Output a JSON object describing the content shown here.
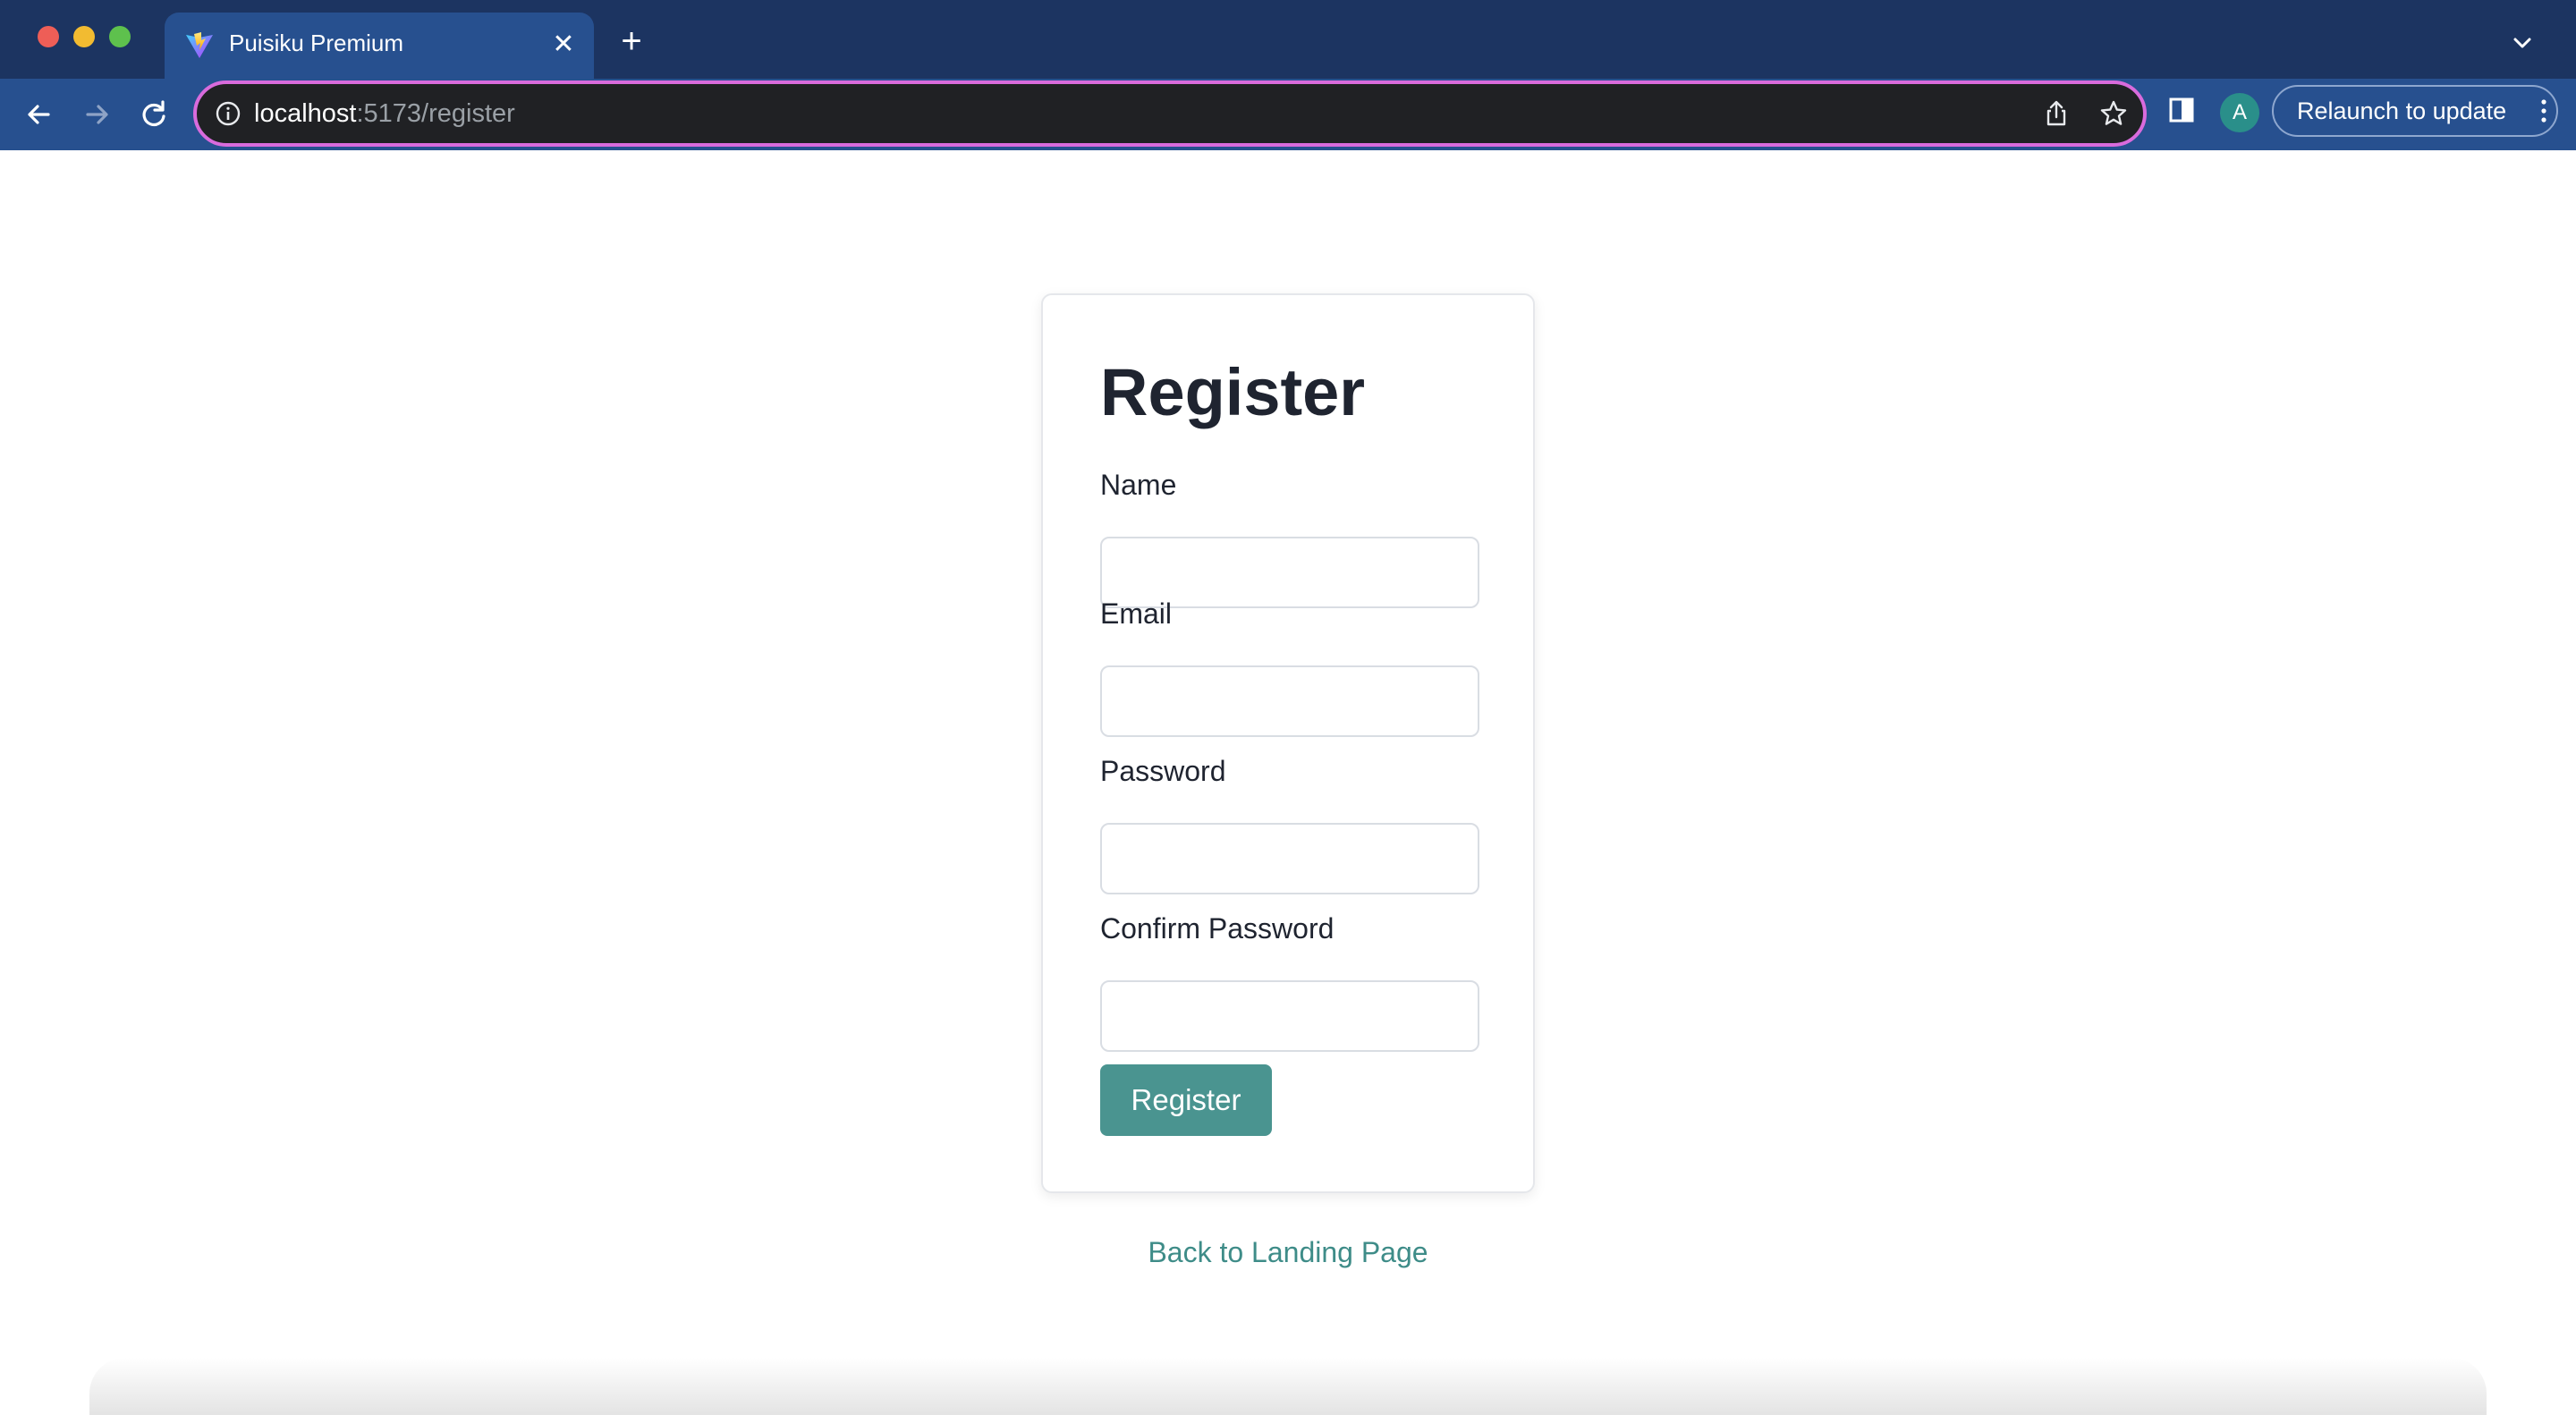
{
  "browser": {
    "tab": {
      "title": "Puisiku Premium",
      "icon": "vite-logo-icon"
    },
    "address_bar": {
      "host": "localhost",
      "path": ":5173/register"
    },
    "profile_initial": "A",
    "relaunch_label": "Relaunch to update",
    "icons": [
      "back-arrow-icon",
      "forward-arrow-icon",
      "reload-icon",
      "info-icon",
      "share-icon",
      "star-icon",
      "side-panel-icon",
      "kebab-menu-icon",
      "close-icon",
      "plus-icon",
      "chevron-down-icon"
    ]
  },
  "form": {
    "title": "Register",
    "fields": [
      {
        "label": "Name",
        "value": "",
        "type": "text"
      },
      {
        "label": "Email",
        "value": "",
        "type": "email"
      },
      {
        "label": "Password",
        "value": "",
        "type": "password"
      },
      {
        "label": "Confirm Password",
        "value": "",
        "type": "password"
      }
    ],
    "submit_label": "Register"
  },
  "back_link": "Back to Landing Page",
  "colors": {
    "chrome_bg": "#1c3461",
    "toolbar_bg": "#27508f",
    "omnibox_focus": "#d96bdc",
    "accent": "#4a9490",
    "link": "#3e8c88"
  }
}
